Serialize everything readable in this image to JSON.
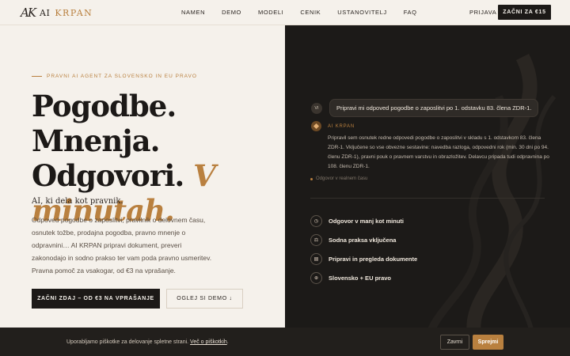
{
  "nav": {
    "logo_mark": "AK",
    "logo_ai": "AI",
    "logo_name": "KRPAN",
    "links": [
      "NAMEN",
      "DEMO",
      "MODELI",
      "CENIK",
      "USTANOVITELJ",
      "FAQ"
    ],
    "login": "PRIJAVA",
    "cta": "ZAČNI ZA €15"
  },
  "hero": {
    "eyebrow": "PRAVNI AI AGENT ZA SLOVENSKO IN EU PRAVO",
    "title_line1": "Pogodbe. Mnenja.",
    "title_line2_a": "Odgovori. ",
    "title_line2_b": "V",
    "title_line3": "minutah.",
    "tagline": "AI, ki dela kot pravnik.",
    "description": "Odpoved pogodbe o zaposlitvi, pravilnik o delovnem času, osnutek tožbe, prodajna pogodba, pravno mnenje o odpravnini… AI KRPAN pripravi dokument, preveri zakonodajo in sodno prakso ter vam poda pravno usmeritev. Pravna pomoč za vsakogar, od €3 na vprašanje.",
    "primary_button": "ZAČNI ZDAJ – OD €3 NA VPRAŠANJE",
    "secondary_button": "OGLEJ SI DEMO ↓"
  },
  "demo": {
    "user_avatar": "VI",
    "user_message": "Pripravi mi odpoved pogodbe o zaposlitvi po 1. odstavku 83. člena ZDR-1.",
    "ai_name": "AI KRPAN",
    "ai_message": "Pripravil sem osnutek redne odpovedi pogodbe o zaposlitvi v skladu s 1. odstavkom 83. člena ZDR-1. Vključene so vse obvezne sestavine: navedba razloga, odpovedni rok (min. 30 dni po 94. členu ZDR-1), pravni pouk o pravnem varstvu in obrazložitev. Delavcu pripada tudi odpravnina po 108. členu ZDR-1.",
    "realtime_label": "Odgovor v realnem času",
    "features": [
      {
        "icon": "clock-icon",
        "glyph": "◷",
        "label": "Odgovor v manj kot minuti"
      },
      {
        "icon": "scales-icon",
        "glyph": "⚖",
        "label": "Sodna praksa vključena"
      },
      {
        "icon": "document-icon",
        "glyph": "▤",
        "label": "Pripravi in pregleda dokumente"
      },
      {
        "icon": "globe-icon",
        "glyph": "⊕",
        "label": "Slovensko + EU pravo"
      }
    ]
  },
  "cookie": {
    "text": "Uporabljamo piškotke za delovanje spletne strani. ",
    "link": "Več o piškotkih",
    "text_end": ".",
    "reject": "Zavrni",
    "accept": "Sprejmi"
  },
  "colors": {
    "accent": "#b9803f",
    "dark": "#1c1917",
    "background": "#f5f1eb"
  }
}
